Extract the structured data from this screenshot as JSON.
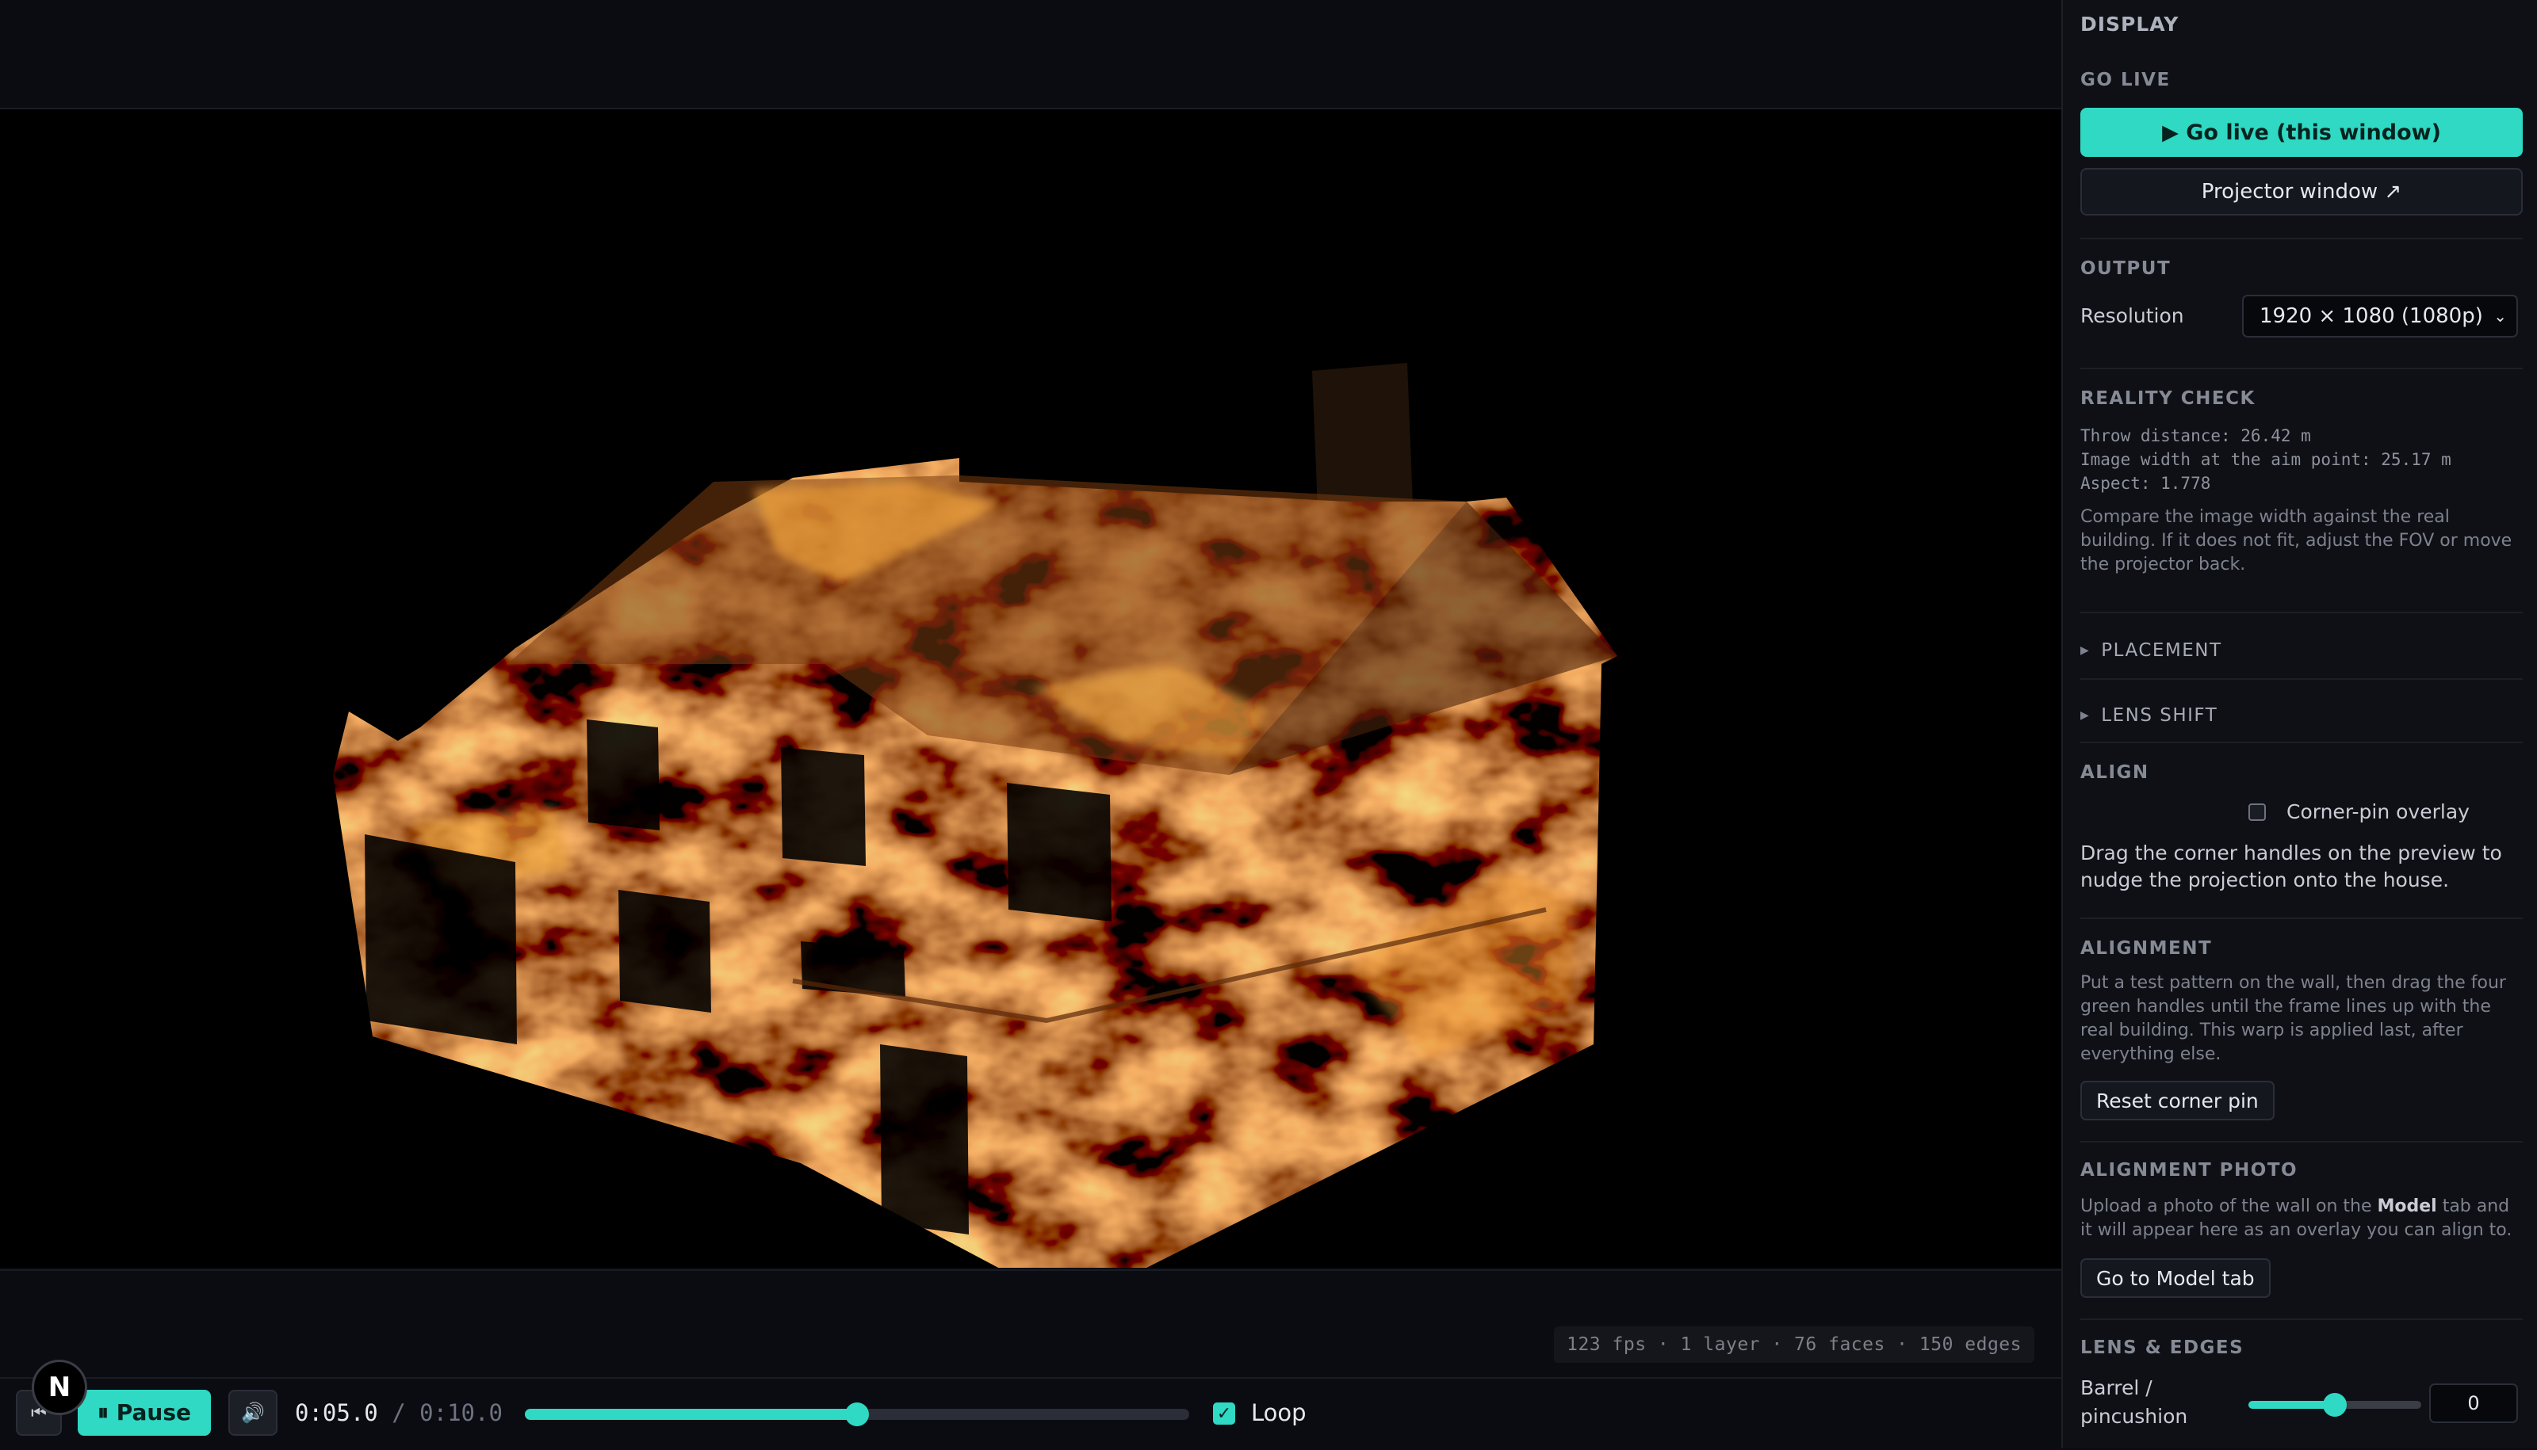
{
  "viewport": {
    "stats": "123 fps · 1 layer · 76 faces · 150 edges"
  },
  "transport": {
    "rewind_icon": "skip-back-icon",
    "pause_icon": "pause-icon",
    "pause_label": "⏸ Pause",
    "volume_icon": "speaker-icon",
    "time_current": "0:05.0",
    "time_separator": "/",
    "time_duration": "0:10.0",
    "progress": 0.5,
    "loop_checked": true,
    "loop_label": "Loop"
  },
  "logo": {
    "letter": "N"
  },
  "panel": {
    "title": "DISPLAY",
    "go_live": {
      "heading": "GO LIVE",
      "primary_label": "▶ Go live (this window)",
      "projector_label": "Projector window ↗"
    },
    "output": {
      "heading": "OUTPUT",
      "resolution_label": "Resolution",
      "resolution_value": "1920 × 1080 (1080p)"
    },
    "reality_check": {
      "heading": "REALITY CHECK",
      "throw": "Throw distance: 26.42 m",
      "width": "Image width at the aim point: 25.17 m",
      "aspect": "Aspect: 1.778",
      "help": "Compare the image width against the real building. If it does not fit, adjust the FOV or move the projector back."
    },
    "placement": {
      "label": "PLACEMENT"
    },
    "lens_shift": {
      "label": "LENS SHIFT"
    },
    "align": {
      "heading": "ALIGN",
      "overlay_label": "Corner-pin overlay",
      "overlay_checked": false,
      "help": "Drag the corner handles on the preview to nudge the projection onto the house."
    },
    "alignment": {
      "heading": "ALIGNMENT",
      "help": "Put a test pattern on the wall, then drag the four green handles until the frame lines up with the real building. This warp is applied last, after everything else.",
      "reset_label": "Reset corner pin"
    },
    "alignment_photo": {
      "heading": "ALIGNMENT PHOTO",
      "help_before": "Upload a photo of the wall on the ",
      "help_bold": "Model",
      "help_after": " tab and it will appear here as an overlay you can align to.",
      "button_label": "Go to Model tab"
    },
    "lens_edges": {
      "heading": "LENS & EDGES",
      "barrel_label_line1": "Barrel /",
      "barrel_label_line2": "pincushion",
      "barrel_slider": 0.5,
      "barrel_value": "0"
    }
  },
  "colors": {
    "accent": "#2fd9c3",
    "background": "#0a0b10",
    "panel": "#0e1016",
    "fire_bright": "#f2a93b",
    "fire_dark": "#3a1a08"
  }
}
